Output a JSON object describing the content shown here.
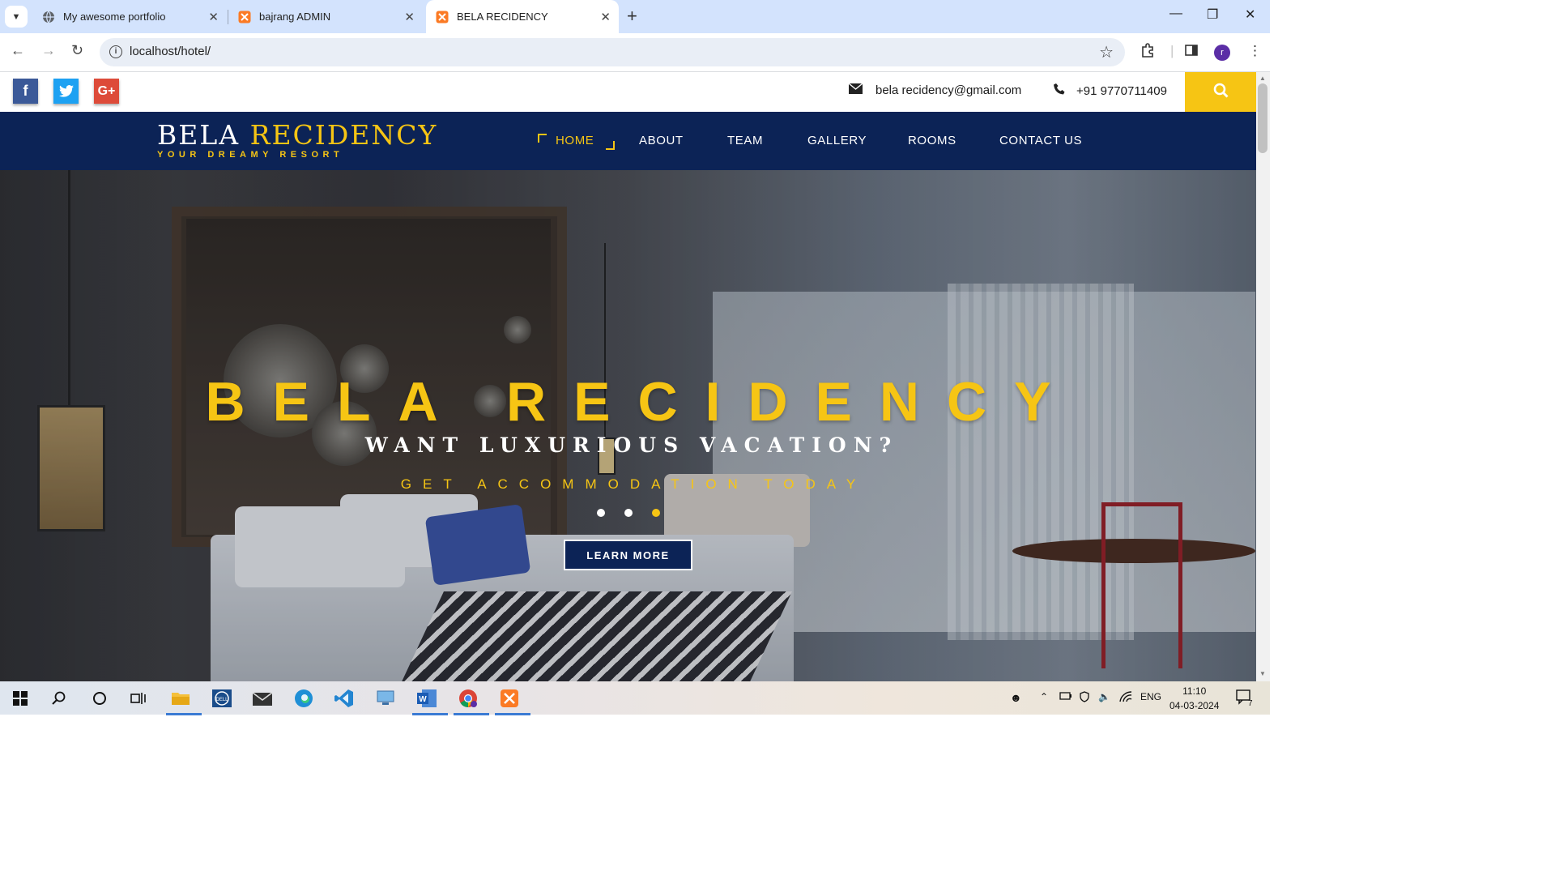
{
  "browser": {
    "tabs": [
      {
        "title": "My awesome portfolio",
        "icon": "globe-icon"
      },
      {
        "title": "bajrang ADMIN",
        "icon": "xampp-icon"
      },
      {
        "title": "BELA RECIDENCY",
        "icon": "xampp-icon",
        "active": true
      }
    ],
    "url": "localhost/hotel/",
    "profile_initial": "r"
  },
  "site": {
    "social": [
      {
        "name": "facebook",
        "glyph": "f",
        "color": "#3b5998"
      },
      {
        "name": "twitter",
        "glyph": "t",
        "color": "#1da1f2"
      },
      {
        "name": "google-plus",
        "glyph": "G+",
        "color": "#dd4b39"
      }
    ],
    "email": "bela recidency@gmail.com",
    "phone": "+91 9770711409",
    "logo": {
      "word1": "BELA",
      "word2": "RECIDENCY",
      "tagline": "YOUR DREAMY RESORT"
    },
    "menu": [
      "HOME",
      "ABOUT",
      "TEAM",
      "GALLERY",
      "ROOMS",
      "CONTACT US"
    ],
    "active_menu": "HOME",
    "hero": {
      "title": "BELA RECIDENCY",
      "subtitle": "WANT LUXURIOUS VACATION?",
      "tagline": "GET ACCOMMODATION TODAY",
      "button": "LEARN MORE",
      "slides": 3,
      "active_slide": 3
    },
    "colors": {
      "navy": "#0c2356",
      "accent": "#f6c514"
    }
  },
  "taskbar": {
    "language": "ENG",
    "time": "11:10",
    "date": "04-03-2024",
    "notification_count": "7"
  }
}
